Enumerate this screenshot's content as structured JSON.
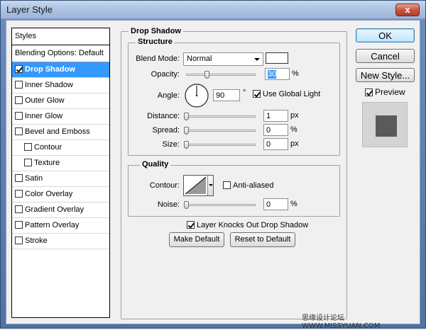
{
  "window": {
    "title": "Layer Style",
    "close_glyph": "x"
  },
  "styles_panel": {
    "header": "Styles",
    "blending_options": "Blending Options: Default",
    "items": [
      {
        "label": "Drop Shadow",
        "checked": true,
        "selected": true,
        "indent": false
      },
      {
        "label": "Inner Shadow",
        "checked": false,
        "selected": false,
        "indent": false
      },
      {
        "label": "Outer Glow",
        "checked": false,
        "selected": false,
        "indent": false
      },
      {
        "label": "Inner Glow",
        "checked": false,
        "selected": false,
        "indent": false
      },
      {
        "label": "Bevel and Emboss",
        "checked": false,
        "selected": false,
        "indent": false
      },
      {
        "label": "Contour",
        "checked": false,
        "selected": false,
        "indent": true
      },
      {
        "label": "Texture",
        "checked": false,
        "selected": false,
        "indent": true
      },
      {
        "label": "Satin",
        "checked": false,
        "selected": false,
        "indent": false
      },
      {
        "label": "Color Overlay",
        "checked": false,
        "selected": false,
        "indent": false
      },
      {
        "label": "Gradient Overlay",
        "checked": false,
        "selected": false,
        "indent": false
      },
      {
        "label": "Pattern Overlay",
        "checked": false,
        "selected": false,
        "indent": false
      },
      {
        "label": "Stroke",
        "checked": false,
        "selected": false,
        "indent": false
      }
    ]
  },
  "drop_shadow": {
    "title": "Drop Shadow",
    "structure": {
      "title": "Structure",
      "blend_mode_label": "Blend Mode:",
      "blend_mode_value": "Normal",
      "shadow_color": "#ffffff",
      "opacity_label": "Opacity:",
      "opacity_value": "30",
      "opacity_unit": "%",
      "opacity_fraction": 0.3,
      "angle_label": "Angle:",
      "angle_value": "90",
      "angle_unit": "°",
      "use_global_light_label": "Use Global Light",
      "use_global_light": true,
      "distance_label": "Distance:",
      "distance_value": "1",
      "distance_unit": "px",
      "spread_label": "Spread:",
      "spread_value": "0",
      "spread_unit": "%",
      "size_label": "Size:",
      "size_value": "0",
      "size_unit": "px"
    },
    "quality": {
      "title": "Quality",
      "contour_label": "Contour:",
      "anti_aliased_label": "Anti-aliased",
      "anti_aliased": false,
      "noise_label": "Noise:",
      "noise_value": "0",
      "noise_unit": "%"
    },
    "knocks_out_label": "Layer Knocks Out Drop Shadow",
    "knocks_out": true,
    "make_default_label": "Make Default",
    "reset_default_label": "Reset to Default"
  },
  "actions": {
    "ok_label": "OK",
    "cancel_label": "Cancel",
    "new_style_label": "New Style...",
    "preview_label": "Preview",
    "preview_checked": true
  },
  "watermark": "思缘设计论坛  WWW.MISSYUAN.COM",
  "colors": {
    "selection": "#3399ff",
    "preview_swatch": "#5a5a5a",
    "titlebar": "#aec4e3"
  }
}
